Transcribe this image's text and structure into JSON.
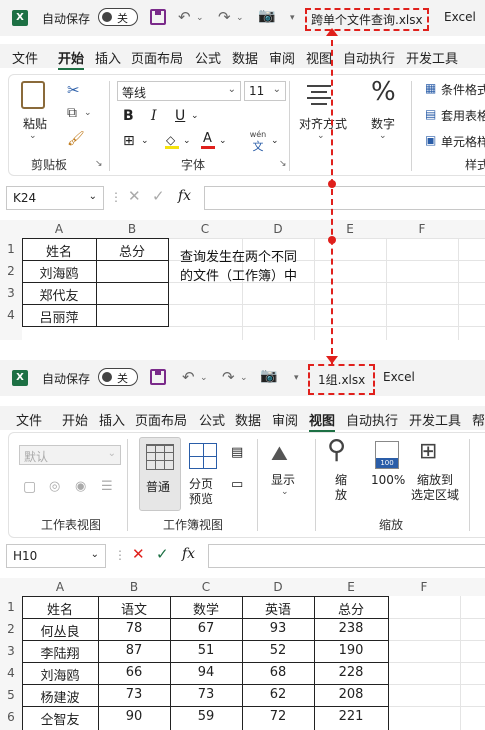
{
  "top": {
    "autosave_label": "自动保存",
    "autosave_state": "关",
    "filename": "跨单个文件查询.xlsx",
    "app": "Excel",
    "menu": [
      "文件",
      "开始",
      "插入",
      "页面布局",
      "公式",
      "数据",
      "审阅",
      "视图",
      "自动执行",
      "开发工具"
    ],
    "active_tab": "开始",
    "ribbon": {
      "paste": "粘贴",
      "clipboard": "剪贴板",
      "font_name": "等线",
      "font_size": "11",
      "bold": "B",
      "italic": "I",
      "underline": "U",
      "font_group": "字体",
      "phonetic": "wén",
      "align": "对齐方式",
      "number": "数字",
      "percent": "%",
      "cond_format": "条件格式",
      "table_format": "套用表格",
      "cell_style": "单元格样",
      "styles_group": "样式"
    },
    "namebox": "K24",
    "fx": "fx",
    "columns": [
      "A",
      "B",
      "C",
      "D",
      "E",
      "F"
    ],
    "rows": [
      "1",
      "2",
      "3",
      "4"
    ],
    "table_header": [
      "姓名",
      "总分"
    ],
    "names": [
      "刘海鸥",
      "郑代友",
      "吕丽萍"
    ],
    "note_line1": "查询发生在两个不同",
    "note_line2": "的文件（工作簿）中"
  },
  "bottom": {
    "autosave_label": "自动保存",
    "autosave_state": "关",
    "filename": "1组.xlsx",
    "app": "Excel",
    "menu": [
      "文件",
      "开始",
      "插入",
      "页面布局",
      "公式",
      "数据",
      "审阅",
      "视图",
      "自动执行",
      "开发工具",
      "帮"
    ],
    "active_tab": "视图",
    "ribbon": {
      "default_view": "默认",
      "sheet_view_group": "工作表视图",
      "normal": "普通",
      "page_break": "分页\n预览",
      "wb_view_group": "工作簿视图",
      "show": "显示",
      "zoom": "缩\n放",
      "zoom100": "100%",
      "zoom100_icon": "100",
      "zoom_sel": "缩放到\n选定区域",
      "zoom_group": "缩放"
    },
    "namebox": "H10",
    "fx": "fx",
    "columns": [
      "A",
      "B",
      "C",
      "D",
      "E",
      "F"
    ],
    "rows": [
      "1",
      "2",
      "3",
      "4",
      "5",
      "6"
    ],
    "table": [
      [
        "姓名",
        "语文",
        "数学",
        "英语",
        "总分"
      ],
      [
        "何丛良",
        "78",
        "67",
        "93",
        "238"
      ],
      [
        "李陆翔",
        "87",
        "51",
        "52",
        "190"
      ],
      [
        "刘海鸥",
        "66",
        "94",
        "68",
        "228"
      ],
      [
        "杨建波",
        "73",
        "73",
        "62",
        "208"
      ],
      [
        "仝智友",
        "90",
        "59",
        "72",
        "221"
      ]
    ]
  },
  "colors": {
    "accent": "#1d7044",
    "highlight": "#e0201c",
    "purple": "#7a2a8a"
  }
}
